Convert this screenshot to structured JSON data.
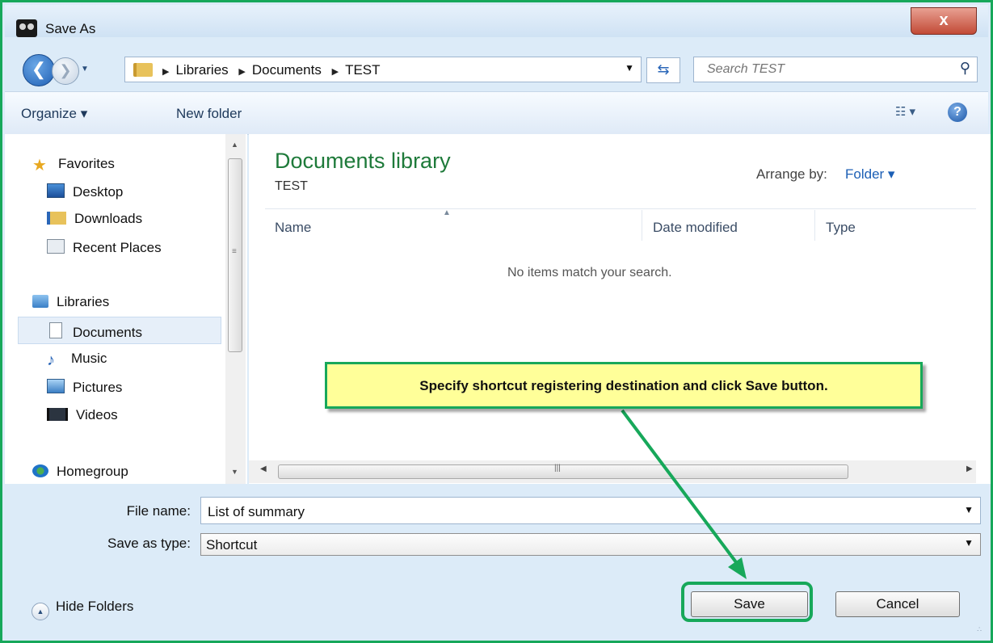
{
  "window": {
    "title": "Save As",
    "close_label": "x"
  },
  "nav": {
    "breadcrumb": [
      "Libraries",
      "Documents",
      "TEST"
    ],
    "search_placeholder": "Search TEST"
  },
  "toolbar": {
    "organize_label": "Organize ▾",
    "new_folder_label": "New folder",
    "views_label": "☷ ▾",
    "help_label": "?"
  },
  "sidebar": {
    "items": [
      {
        "label": "Favorites",
        "icon": "star-icon"
      },
      {
        "label": "Desktop",
        "icon": "desktop-icon"
      },
      {
        "label": "Downloads",
        "icon": "downloads-folder-icon"
      },
      {
        "label": "Recent Places",
        "icon": "recent-places-icon"
      },
      {
        "label": "Libraries",
        "icon": "libraries-icon"
      },
      {
        "label": "Documents",
        "icon": "documents-icon",
        "selected": true
      },
      {
        "label": "Music",
        "icon": "music-icon"
      },
      {
        "label": "Pictures",
        "icon": "pictures-icon"
      },
      {
        "label": "Videos",
        "icon": "videos-icon"
      },
      {
        "label": "Homegroup",
        "icon": "homegroup-icon"
      }
    ]
  },
  "content": {
    "library_title": "Documents library",
    "library_subtitle": "TEST",
    "arrange_label": "Arrange by:",
    "arrange_value": "Folder ▾",
    "columns": [
      "Name",
      "Date modified",
      "Type"
    ],
    "empty_message": "No items match your search."
  },
  "fields": {
    "file_name_label": "File name:",
    "file_name_value": "List of summary",
    "save_type_label": "Save as type:",
    "save_type_value": "Shortcut"
  },
  "footer": {
    "hide_folders_label": "Hide Folders",
    "save_label": "Save",
    "cancel_label": "Cancel"
  },
  "annotation": {
    "callout_text": "Specify shortcut registering destination and click Save button.",
    "accent_color": "#17a85a",
    "callout_color": "#ffff99"
  }
}
